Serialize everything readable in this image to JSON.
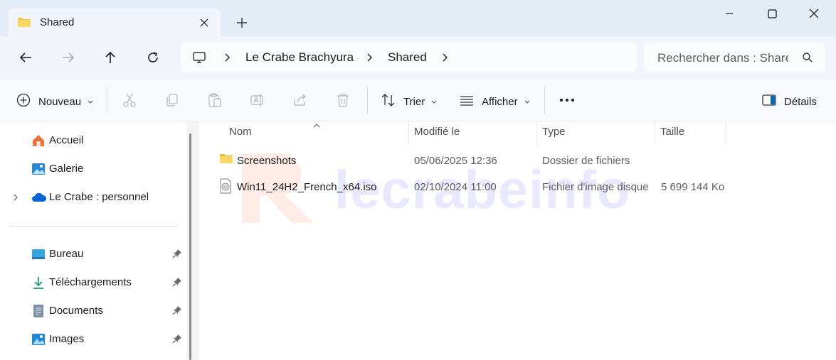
{
  "tab": {
    "title": "Shared",
    "folder_icon": "folder-icon",
    "close_icon": "close-icon"
  },
  "new_tab_icon": "plus-icon",
  "window_controls": [
    "minimize-icon",
    "maximize-icon",
    "close-icon"
  ],
  "nav": [
    "back-arrow-icon",
    "forward-arrow-icon",
    "up-arrow-icon",
    "refresh-icon"
  ],
  "breadcrumb": {
    "root_icon": "monitor-icon",
    "items": [
      "Le Crabe Brachyura",
      "Shared"
    ]
  },
  "search": {
    "placeholder": "Rechercher dans : Shared"
  },
  "toolbar": {
    "new_label": "Nouveau",
    "sort_label": "Trier",
    "view_label": "Afficher",
    "details_label": "Détails",
    "disabled_icons": [
      "cut-icon",
      "copy-icon",
      "paste-icon",
      "rename-icon",
      "share-icon",
      "delete-icon"
    ]
  },
  "sidebar": {
    "top_items": [
      {
        "label": "Accueil",
        "icon": "home-icon"
      },
      {
        "label": "Galerie",
        "icon": "gallery-icon"
      },
      {
        "label": "Le Crabe : personnel",
        "icon": "onedrive-cloud-icon"
      }
    ],
    "pinned_items": [
      {
        "label": "Bureau",
        "icon": "desktop-icon"
      },
      {
        "label": "Téléchargements",
        "icon": "download-icon"
      },
      {
        "label": "Documents",
        "icon": "document-icon"
      },
      {
        "label": "Images",
        "icon": "images-icon"
      }
    ]
  },
  "columns": {
    "name": "Nom",
    "modified": "Modifié le",
    "type": "Type",
    "size": "Taille"
  },
  "files": [
    {
      "name": "Screenshots",
      "modified": "05/06/2025 12:36",
      "type": "Dossier de fichiers",
      "size": "",
      "icon": "folder-icon"
    },
    {
      "name": "Win11_24H2_French_x64.iso",
      "modified": "02/10/2024 11:00",
      "type": "Fichier d'image disque",
      "size": "5 699 144 Ko",
      "icon": "disc-image-icon"
    }
  ],
  "watermark": {
    "text": "lecrabeinfo"
  },
  "colors": {
    "accent": "#0067c0",
    "folder": "#f8c53a",
    "titlebar": "#e4ecf6",
    "addressbar": "#f2f6fc"
  }
}
